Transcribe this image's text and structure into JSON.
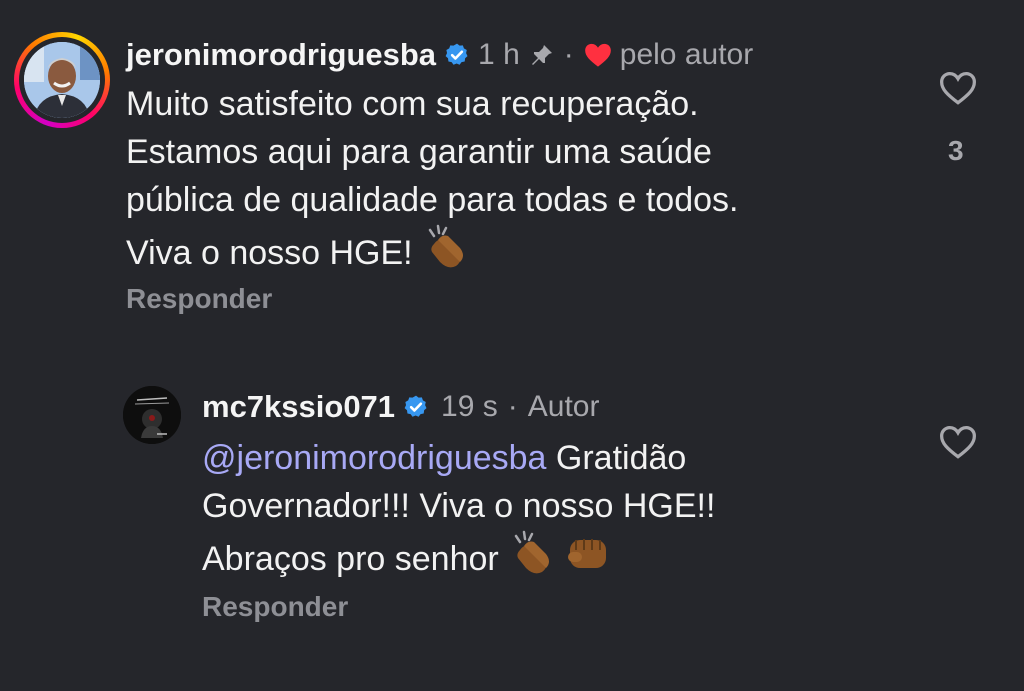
{
  "comments": [
    {
      "username": "jeronimorodriguesba",
      "time": "1 h",
      "liked_by_author_label": "pelo autor",
      "lines": [
        "Muito satisfeito com sua recuperação.",
        "Estamos aqui para garantir uma saúde",
        "pública de qualidade para todas e todos.",
        "Viva o nosso HGE!"
      ],
      "reply_label": "Responder",
      "like_count": "3"
    },
    {
      "username": "mc7kssio071",
      "time": "19 s",
      "author_label": "Autor",
      "mention": "@jeronimorodriguesba",
      "line1_rest": " Gratidão",
      "line2": "Governador!!! Viva o nosso HGE!!",
      "line3": "Abraços pro senhor",
      "reply_label": "Responder"
    }
  ],
  "colors": {
    "background": "#25262b",
    "verified": "#3797f0",
    "heart": "#ff3040",
    "mention": "#a8a9f5",
    "muted": "#a8a8ad"
  },
  "icons": [
    "verified-badge-icon",
    "pin-icon",
    "heart-icon",
    "heart-outline-icon",
    "clapping-hands-icon",
    "fist-icon"
  ]
}
